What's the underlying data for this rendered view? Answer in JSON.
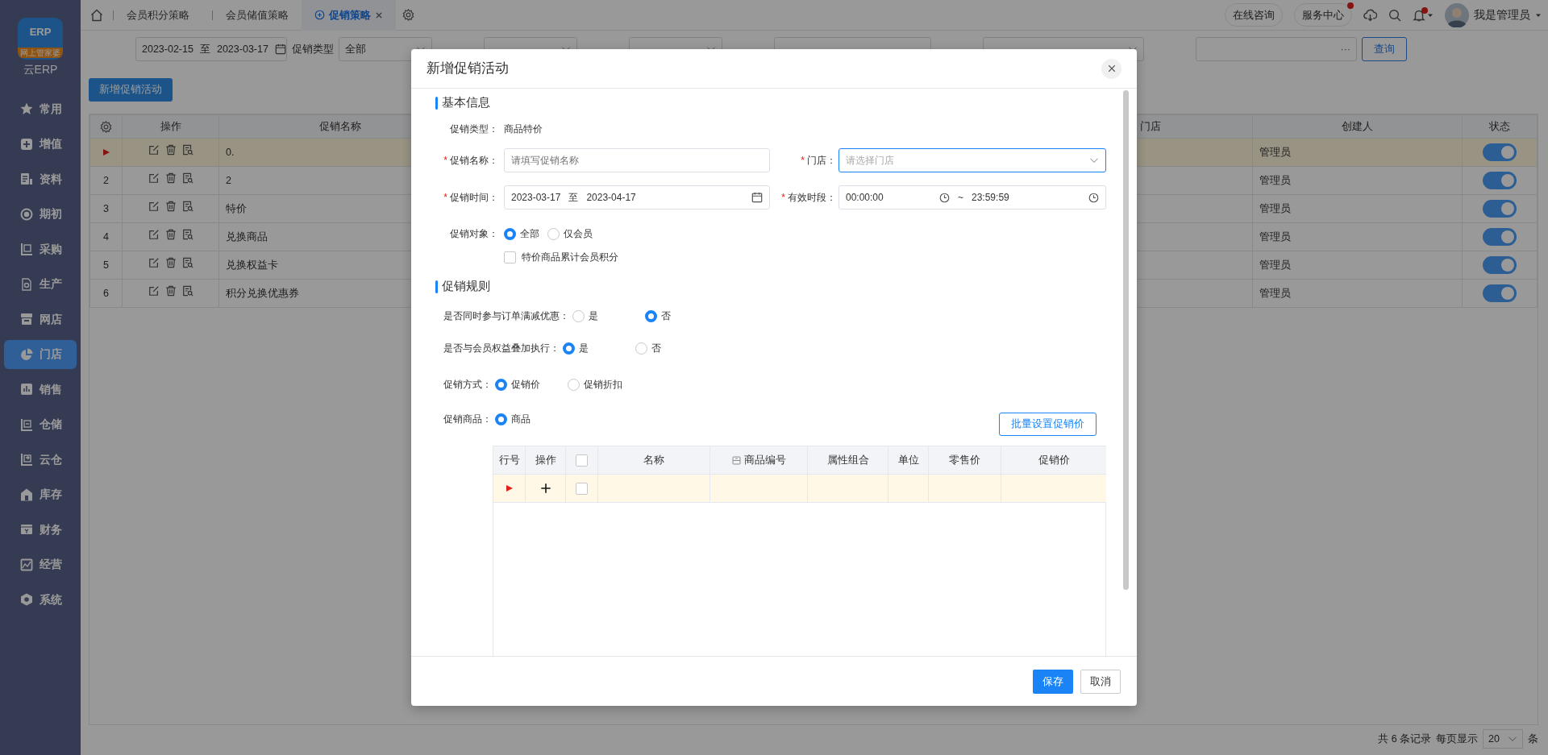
{
  "logo": {
    "mark": "ERP",
    "ribbon": "网上管家婆",
    "name": "云ERP"
  },
  "sidebar": {
    "items": [
      {
        "label": "常用",
        "selected": false
      },
      {
        "label": "增值",
        "selected": false
      },
      {
        "label": "资料",
        "selected": false
      },
      {
        "label": "期初",
        "selected": false
      },
      {
        "label": "采购",
        "selected": false
      },
      {
        "label": "生产",
        "selected": false
      },
      {
        "label": "网店",
        "selected": false
      },
      {
        "label": "门店",
        "selected": true
      },
      {
        "label": "销售",
        "selected": false
      },
      {
        "label": "仓储",
        "selected": false
      },
      {
        "label": "云仓",
        "selected": false
      },
      {
        "label": "库存",
        "selected": false
      },
      {
        "label": "财务",
        "selected": false
      },
      {
        "label": "经营",
        "selected": false
      },
      {
        "label": "系统",
        "selected": false
      }
    ]
  },
  "tabs": [
    {
      "label": "会员积分策略",
      "selected": false
    },
    {
      "label": "会员储值策略",
      "selected": false
    },
    {
      "label": "促销策略",
      "selected": true
    }
  ],
  "header": {
    "links": [
      {
        "label": "在线咨询",
        "badge": false
      },
      {
        "label": "服务中心",
        "badge": true
      }
    ],
    "bell_badge": true,
    "user": "我是管理员"
  },
  "filters": [
    {
      "kind": "daterange",
      "start": "2023-02-15",
      "sep": "至",
      "end": "2023-03-17"
    },
    {
      "kind": "select",
      "label": "促销类型",
      "value": "全部"
    },
    {
      "kind": "select"
    },
    {
      "kind": "select"
    },
    {
      "kind": "input"
    },
    {
      "kind": "select"
    },
    {
      "kind": "picker",
      "button": "···"
    }
  ],
  "query_button": "查询",
  "new_button": "新增促销活动",
  "table": {
    "columns": [
      "操作",
      "促销名称",
      "门店",
      "创建人",
      "状态"
    ],
    "rows": [
      {
        "selected": true,
        "name": "0.",
        "creator": "管理员",
        "enabled": true
      },
      {
        "selected": false,
        "no": "2",
        "name": "2",
        "creator": "管理员",
        "enabled": true
      },
      {
        "selected": false,
        "no": "3",
        "name": "特价",
        "creator": "管理员",
        "enabled": true
      },
      {
        "selected": false,
        "no": "4",
        "name": "兑换商品",
        "creator": "管理员",
        "enabled": true
      },
      {
        "selected": false,
        "no": "5",
        "name": "兑换权益卡",
        "creator": "管理员",
        "enabled": true
      },
      {
        "selected": false,
        "no": "6",
        "name": "积分兑换优惠券",
        "creator": "管理员",
        "enabled": true
      }
    ]
  },
  "pagination": {
    "summary": "共 6 条记录",
    "per_page_label": "每页显示",
    "per_page": "20",
    "unit": "条"
  },
  "dialog": {
    "title": "新增促销活动",
    "basic": {
      "title": "基本信息",
      "type_label": "促销类型：",
      "type_value": "商品特价",
      "name": {
        "mark": "*",
        "label": "促销名称：",
        "placeholder": "请填写促销名称"
      },
      "store": {
        "mark": "*",
        "label": "门店：",
        "placeholder": "请选择门店",
        "focused": true
      },
      "period": {
        "mark": "*",
        "label": "促销时间：",
        "start": "2023-03-17",
        "sep": "至",
        "end": "2023-04-17"
      },
      "hours": {
        "mark": "*",
        "label": "有效时段：",
        "start": "00:00:00",
        "sep": "~",
        "end": "23:59:59"
      },
      "target": {
        "label": "促销对象：",
        "options": [
          {
            "label": "全部",
            "selected": true
          },
          {
            "label": "仅会员",
            "selected": false
          }
        ]
      },
      "points": {
        "label": "特价商品累计会员积分",
        "checked": false
      }
    },
    "rules": {
      "title": "促销规则",
      "questions": [
        {
          "label": "是否同时参与订单满减优惠：",
          "options": [
            {
              "label": "是",
              "selected": false
            },
            {
              "label": "否",
              "selected": true
            }
          ]
        },
        {
          "label": "是否与会员权益叠加执行：",
          "options": [
            {
              "label": "是",
              "selected": true
            },
            {
              "label": "否",
              "selected": false
            }
          ]
        },
        {
          "label": "促销方式：",
          "options": [
            {
              "label": "促销价",
              "selected": true
            },
            {
              "label": "促销折扣",
              "selected": false
            }
          ]
        },
        {
          "label": "促销商品：",
          "options": [
            {
              "label": "商品",
              "selected": true
            }
          ]
        }
      ],
      "batch_button": "批量设置促销价"
    },
    "grid": {
      "columns": [
        {
          "kind": "text",
          "label": "行号"
        },
        {
          "kind": "text",
          "label": "操作"
        },
        {
          "kind": "checkbox",
          "checked": false
        },
        {
          "kind": "text",
          "label": "名称"
        },
        {
          "kind": "coded",
          "label": "商品编号"
        },
        {
          "kind": "text",
          "label": "属性组合"
        },
        {
          "kind": "text",
          "label": "单位"
        },
        {
          "kind": "text",
          "label": "零售价"
        },
        {
          "kind": "text",
          "label": "促销价"
        }
      ],
      "rows": [
        {
          "selected": true,
          "checked": false
        }
      ]
    },
    "buttons": [
      {
        "label": "保存",
        "primary": true
      },
      {
        "label": "取消",
        "primary": false
      }
    ]
  }
}
